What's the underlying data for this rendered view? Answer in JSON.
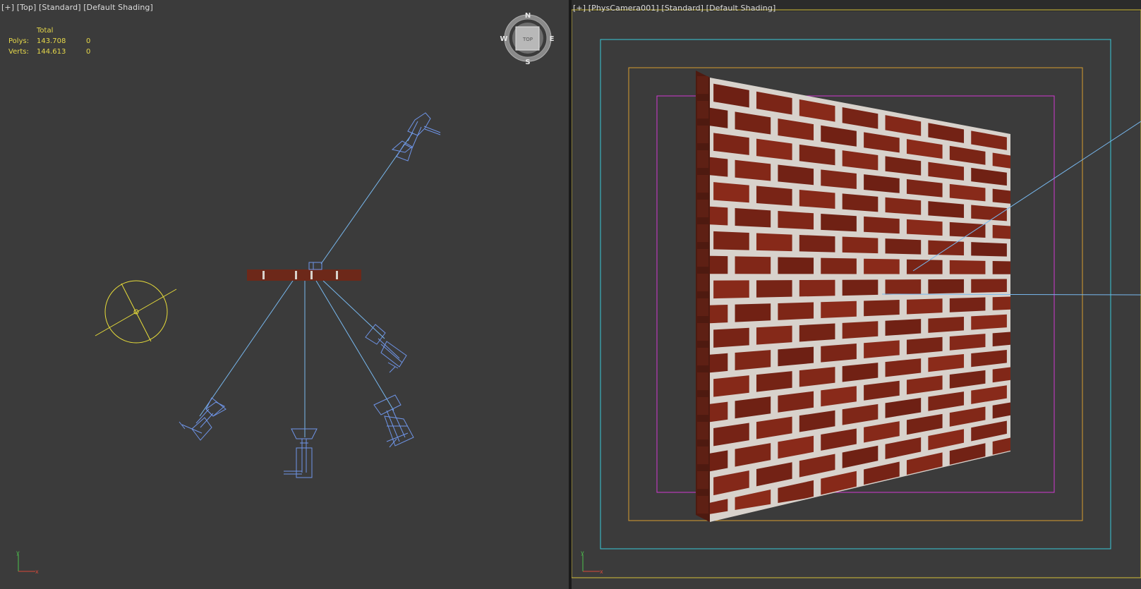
{
  "left_viewport": {
    "labels": [
      "[+]",
      "[Top]",
      "[Standard]",
      "[Default Shading]"
    ],
    "stats": {
      "header": "Total",
      "rows": [
        {
          "label": "Polys:",
          "total": "143.708",
          "selected": "0"
        },
        {
          "label": "Verts:",
          "total": "144.613",
          "selected": "0"
        }
      ]
    },
    "viewcube": {
      "face": "TOP",
      "north": "N",
      "south": "S",
      "east": "E",
      "west": "W"
    },
    "axis": {
      "x": "x",
      "y": "y"
    }
  },
  "right_viewport": {
    "labels": [
      "[+]",
      "[PhysCamera001]",
      "[Standard]",
      "[Default Shading]"
    ],
    "axis": {
      "x": "x",
      "y": "y"
    }
  },
  "colors": {
    "viewport_bg": "#3b3b3b",
    "label_text": "#dcdcdc",
    "stats_text": "#e6d84a",
    "light_wire": "#6f95e8",
    "light_line": "#78b8ee",
    "sun_yellow": "#e8dd3a",
    "safe_frame_yellow": "#d6c23a",
    "safe_frame_cyan": "#38c8d8",
    "safe_frame_orange": "#d79c2f",
    "safe_frame_magenta": "#d03ad0",
    "brick": "#7a2e1c",
    "mortar": "#d8d2cc"
  }
}
